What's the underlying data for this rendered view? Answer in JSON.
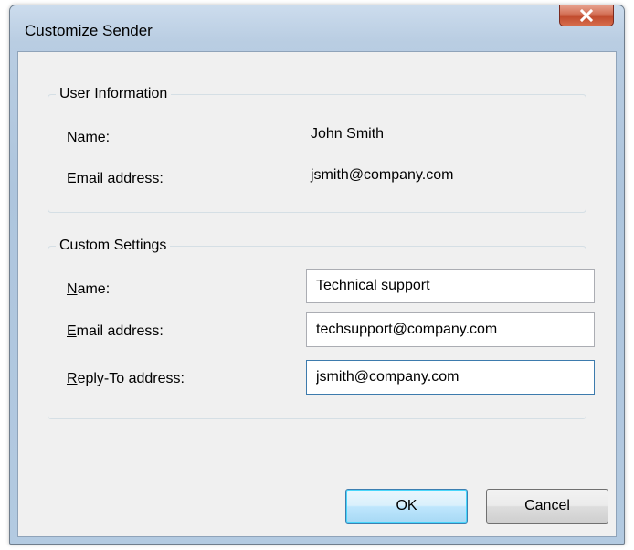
{
  "window": {
    "title": "Customize Sender"
  },
  "user_information": {
    "legend": "User Information",
    "name_label": "Name:",
    "name_value": "John Smith",
    "email_label": "Email address:",
    "email_value": "jsmith@company.com"
  },
  "custom_settings": {
    "legend": "Custom Settings",
    "name_label_accel": "N",
    "name_label_rest": "ame:",
    "name_value": "Technical support",
    "email_label_accel": "E",
    "email_label_rest": "mail address:",
    "email_value": "techsupport@company.com",
    "reply_label_accel": "R",
    "reply_label_rest": "eply-To address:",
    "reply_value": "jsmith@company.com"
  },
  "buttons": {
    "ok": "OK",
    "cancel": "Cancel"
  },
  "icons": {
    "close": "close-icon"
  },
  "colors": {
    "close_button": "#c04a2d",
    "focus_border": "#3d7bad",
    "default_button_border": "#3c7fb1"
  }
}
